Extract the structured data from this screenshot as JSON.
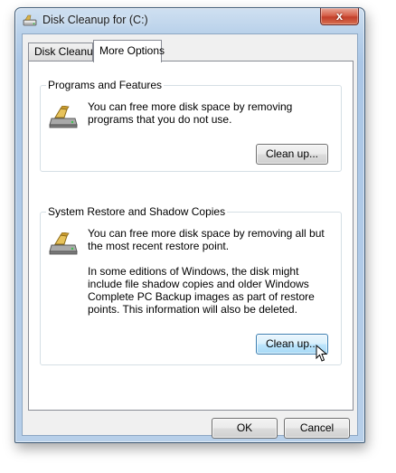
{
  "window": {
    "title": "Disk Cleanup for  (C:)",
    "close_label": "x"
  },
  "tabs": [
    {
      "label": "Disk Cleanup",
      "active": false
    },
    {
      "label": "More Options",
      "active": true
    }
  ],
  "programs": {
    "title": "Programs and Features",
    "description": "You can free more disk space by removing programs that you do not use.",
    "button_label": "Clean up...",
    "icon": "drive-icon"
  },
  "restore": {
    "title": "System Restore and Shadow Copies",
    "description": "You can free more disk space by removing all but the most recent restore point.",
    "details": "In some editions of Windows, the disk might include file shadow copies and older Windows Complete PC Backup images as part of restore points. This information will also be deleted.",
    "button_label": "Clean up...",
    "icon": "drive-icon"
  },
  "footer": {
    "ok_label": "OK",
    "cancel_label": "Cancel"
  },
  "colors": {
    "window_frame": "#b9d1ea",
    "close_button": "#c8452f",
    "focus_button": "#bee6fd"
  }
}
